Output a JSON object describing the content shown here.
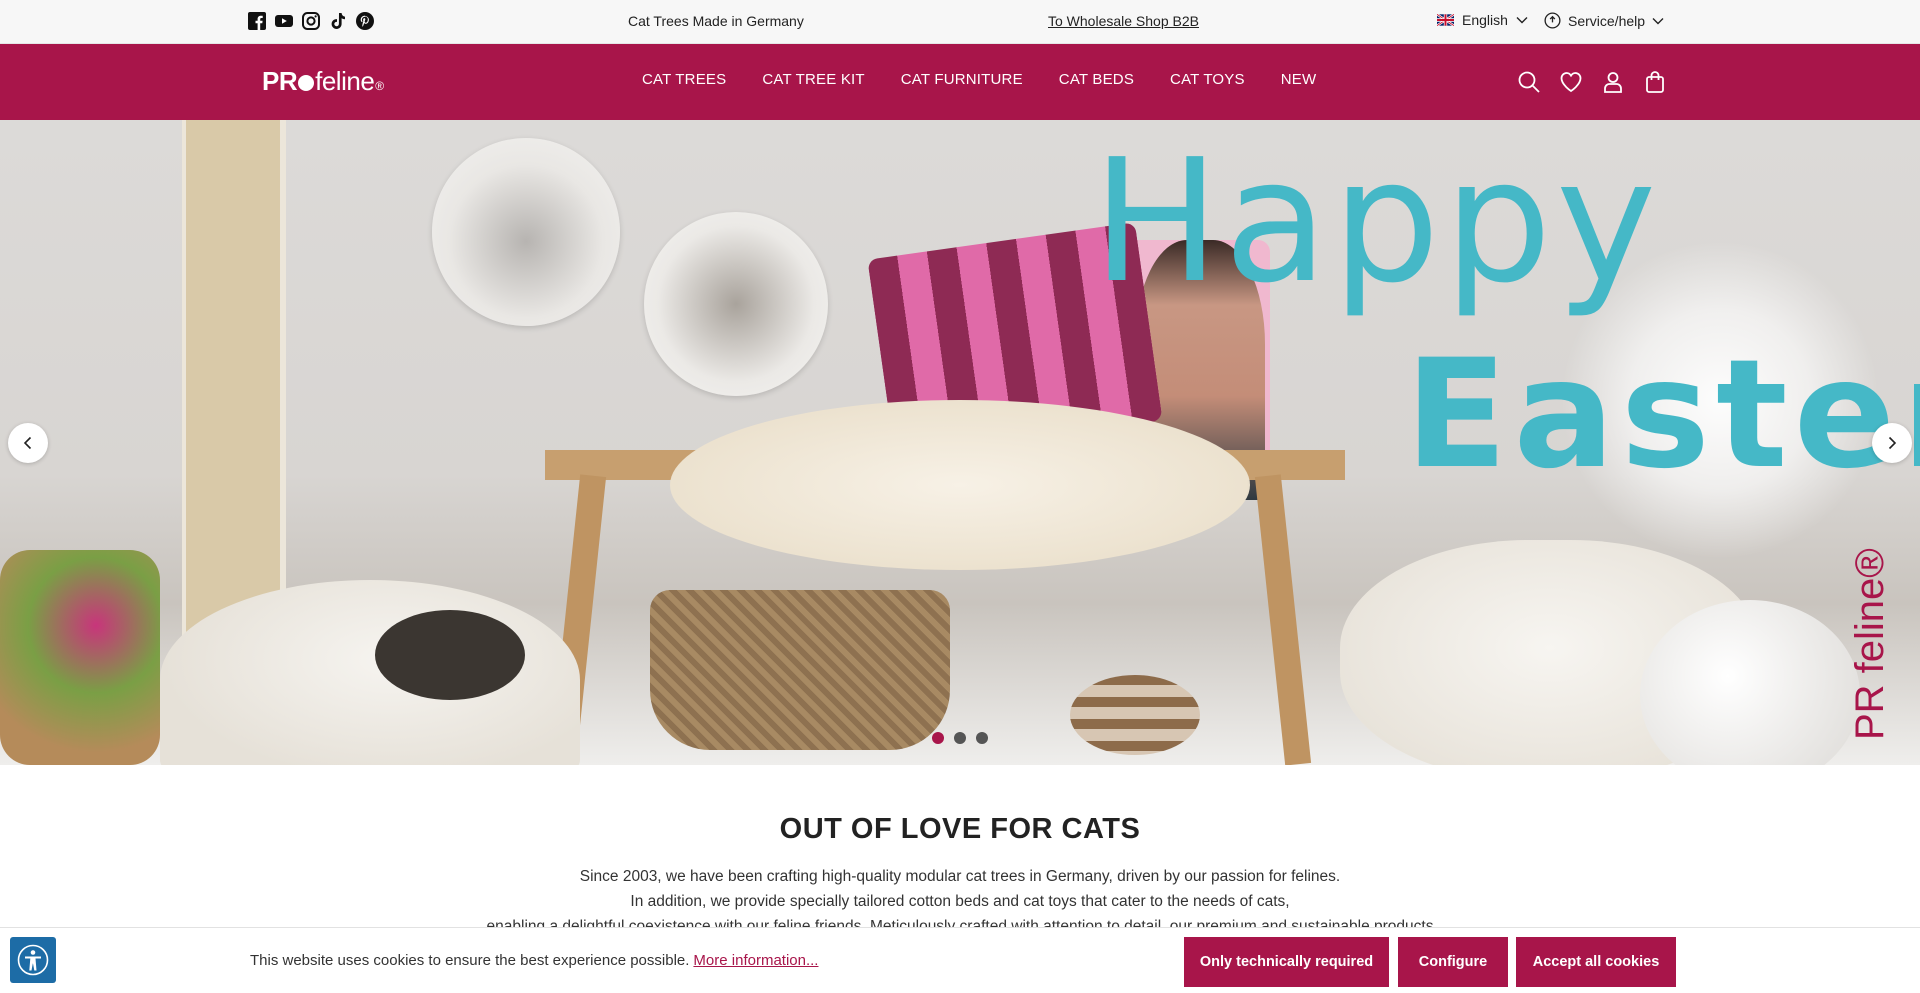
{
  "topbar": {
    "social_icons": [
      "facebook-icon",
      "youtube-icon",
      "instagram-icon",
      "tiktok-icon",
      "pinterest-icon"
    ],
    "tagline": "Cat Trees Made in Germany",
    "b2b_link": "To Wholesale Shop B2B",
    "language": "English",
    "help": "Service/help"
  },
  "header": {
    "logo": {
      "pr": "PR",
      "feline": "feline",
      "reg": "®"
    },
    "nav": [
      "CAT TREES",
      "CAT TREE KIT",
      "CAT FURNITURE",
      "CAT BEDS",
      "CAT TOYS",
      "NEW"
    ],
    "icons": [
      "search-icon",
      "heart-icon",
      "account-icon",
      "bag-icon"
    ]
  },
  "hero": {
    "headline_1": "Happy",
    "headline_2": "Easter",
    "watermark": "PR feline®",
    "slide_count": 3,
    "active_slide": 1
  },
  "intro": {
    "title_light": "OUT OF",
    "title_bold": "LOVE FOR CATS",
    "lines": [
      "Since 2003, we have been crafting high-quality modular cat trees in Germany, driven by our passion for felines.",
      "In addition, we provide specially tailored cotton beds and cat toys that cater to the needs of cats,",
      "enabling a delightful coexistence with our feline friends. Meticulously crafted with attention to detail, our premium and sustainable products"
    ]
  },
  "cookie": {
    "text": "This website uses cookies to ensure the best experience possible.",
    "link": "More information...",
    "btn_required": "Only technically required",
    "btn_configure": "Configure",
    "btn_accept": "Accept all cookies"
  },
  "colors": {
    "brand": "#a8154a",
    "accent_teal": "#45b8c7",
    "a11y_blue": "#1d6ca6"
  }
}
